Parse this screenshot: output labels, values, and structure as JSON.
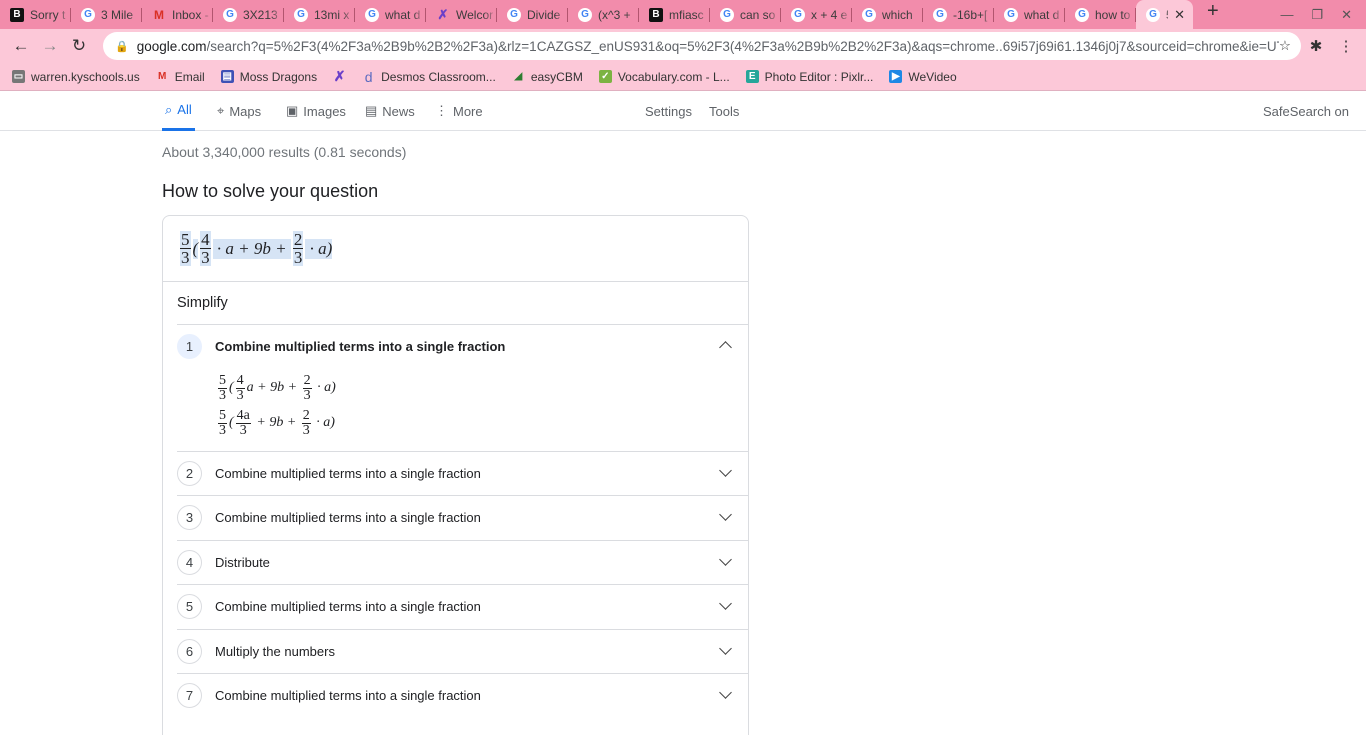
{
  "tabs": [
    {
      "icon": "b",
      "label": "Sorry t"
    },
    {
      "icon": "g",
      "label": "3 Mile"
    },
    {
      "icon": "m",
      "label": "Inbox -"
    },
    {
      "icon": "g",
      "label": "3X213"
    },
    {
      "icon": "g",
      "label": "13mi x"
    },
    {
      "icon": "g",
      "label": "what d"
    },
    {
      "icon": "x",
      "label": "Welcor"
    },
    {
      "icon": "g",
      "label": "Divide"
    },
    {
      "icon": "g",
      "label": "(x^3 +"
    },
    {
      "icon": "b",
      "label": "mfiasc"
    },
    {
      "icon": "g",
      "label": "can so"
    },
    {
      "icon": "g",
      "label": "x + 4 e"
    },
    {
      "icon": "g",
      "label": "which"
    },
    {
      "icon": "g",
      "label": "-16b+["
    },
    {
      "icon": "g",
      "label": "what d"
    },
    {
      "icon": "g",
      "label": "how to"
    },
    {
      "icon": "g",
      "label": "5/3",
      "active": true
    }
  ],
  "omnibox": {
    "host": "google.com",
    "path": "/search?q=5%2F3(4%2F3a%2B9b%2B2%2F3a)&rlz=1CAZGSZ_enUS931&oq=5%2F3(4%2F3a%2B9b%2B2%2F3a)&aqs=chrome..69i57j69i61.1346j0j7&sourceid=chrome&ie=UTF-8&safe=acti..."
  },
  "bookmarks": [
    "warren.kyschools.us",
    "Email",
    "Moss Dragons",
    "",
    "Desmos Classroom...",
    "easyCBM",
    "Vocabulary.com - L...",
    "Photo Editor : Pixlr...",
    "WeVideo"
  ],
  "nav": {
    "all": "All",
    "maps": "Maps",
    "images": "Images",
    "news": "News",
    "more": "More",
    "settings": "Settings",
    "tools": "Tools",
    "safesearch": "SafeSearch on"
  },
  "stats": "About 3,340,000 results (0.81 seconds)",
  "heading": "How to solve your question",
  "simplify": "Simplify",
  "problem": [
    {
      "f": [
        "5",
        "3"
      ]
    },
    {
      "t": "("
    },
    {
      "f": [
        "4",
        "3"
      ]
    },
    {
      "t": " · a + 9b + "
    },
    {
      "f": [
        "2",
        "3"
      ]
    },
    {
      "t": " · a)"
    }
  ],
  "work": [
    [
      {
        "f": [
          "5",
          "3"
        ]
      },
      {
        "t": "("
      },
      {
        "f": [
          "4",
          "3"
        ]
      },
      {
        "t": "a + 9b + "
      },
      {
        "f": [
          "2",
          "3"
        ]
      },
      {
        "t": " · a)"
      }
    ],
    [
      {
        "f": [
          "5",
          "3"
        ]
      },
      {
        "t": "("
      },
      {
        "f": [
          "4a",
          "3"
        ]
      },
      {
        "t": " + 9b + "
      },
      {
        "f": [
          "2",
          "3"
        ]
      },
      {
        "t": " · a)"
      }
    ]
  ],
  "steps": [
    {
      "n": "1",
      "title": "Combine multiplied terms into a single fraction"
    },
    {
      "n": "2",
      "title": "Combine multiplied terms into a single fraction"
    },
    {
      "n": "3",
      "title": "Combine multiplied terms into a single fraction"
    },
    {
      "n": "4",
      "title": "Distribute"
    },
    {
      "n": "5",
      "title": "Combine multiplied terms into a single fraction"
    },
    {
      "n": "6",
      "title": "Multiply the numbers"
    },
    {
      "n": "7",
      "title": "Combine multiplied terms into a single fraction"
    }
  ]
}
